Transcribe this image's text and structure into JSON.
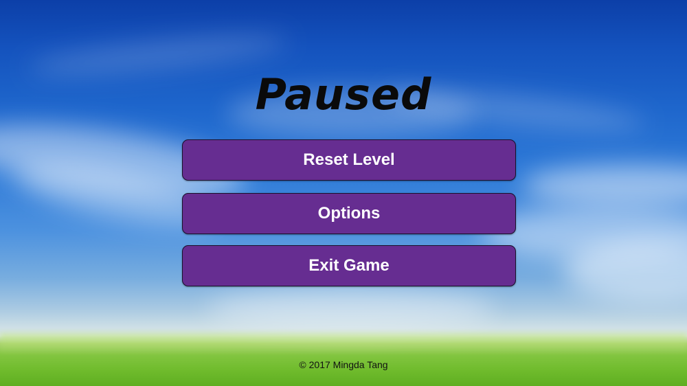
{
  "screen": {
    "title": "Paused",
    "menu": {
      "reset_level": "Reset Level",
      "options": "Options",
      "exit_game": "Exit Game"
    },
    "footer": {
      "copyright": "© 2017 Mingda Tang"
    }
  },
  "colors": {
    "button_fill": "#662d91",
    "button_border": "#1a0f2a",
    "button_text": "#ffffff",
    "title_text": "#0a0a0a",
    "sky_top": "#0c3fa8",
    "grass": "#6fbb2c"
  },
  "background": {
    "scene": "sky-clouds-grass"
  }
}
